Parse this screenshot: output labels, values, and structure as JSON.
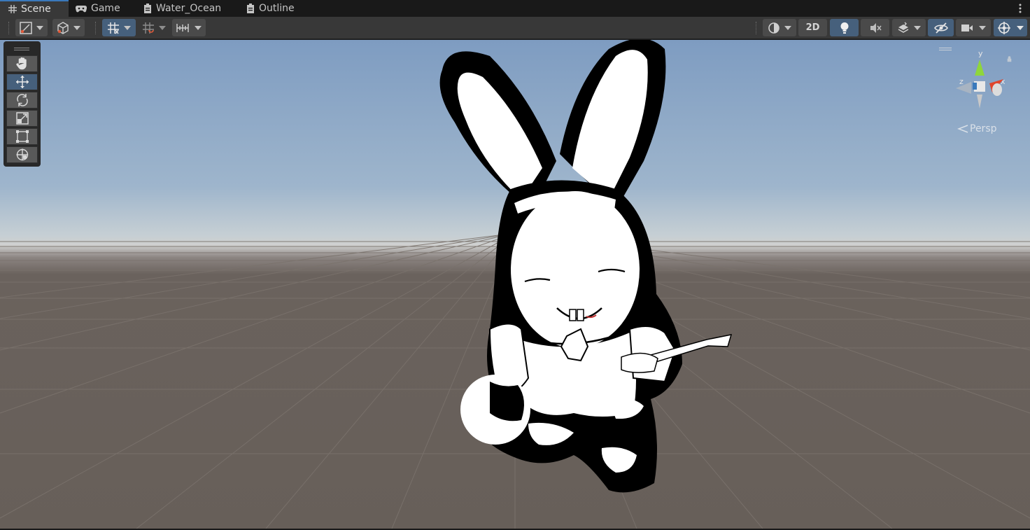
{
  "tabs": [
    {
      "label": "Scene",
      "icon": "grid-icon",
      "active": true
    },
    {
      "label": "Game",
      "icon": "gamepad-icon",
      "active": false
    },
    {
      "label": "Water_Ocean",
      "icon": "script-icon",
      "active": false
    },
    {
      "label": "Outline",
      "icon": "script-icon",
      "active": false
    }
  ],
  "toolbar": {
    "two_d_label": "2D",
    "left_tools": [
      "draw-mode-icon",
      "shading-cube-icon",
      "grid-snap-icon",
      "increment-snap-icon",
      "ruler-icon"
    ],
    "right_tools": [
      "render-mode-icon",
      "2d-toggle",
      "lighting-icon",
      "audio-mute-icon",
      "effects-layers-icon",
      "scene-visibility-icon",
      "camera-icon",
      "gizmos-icon"
    ]
  },
  "palette": {
    "tools": [
      "hand-icon",
      "move-icon",
      "rotate-icon",
      "scale-icon",
      "rect-icon",
      "transform-icon"
    ],
    "selected": "move-icon"
  },
  "gizmo": {
    "axes": {
      "y": "y",
      "x": "x",
      "z": "z"
    },
    "projection": "Persp"
  },
  "colors": {
    "accent": "#3a79bb",
    "selected": "#46607c",
    "axis_x": "#e0452b",
    "axis_y": "#8fd63a",
    "axis_z": "#3a79bb"
  }
}
